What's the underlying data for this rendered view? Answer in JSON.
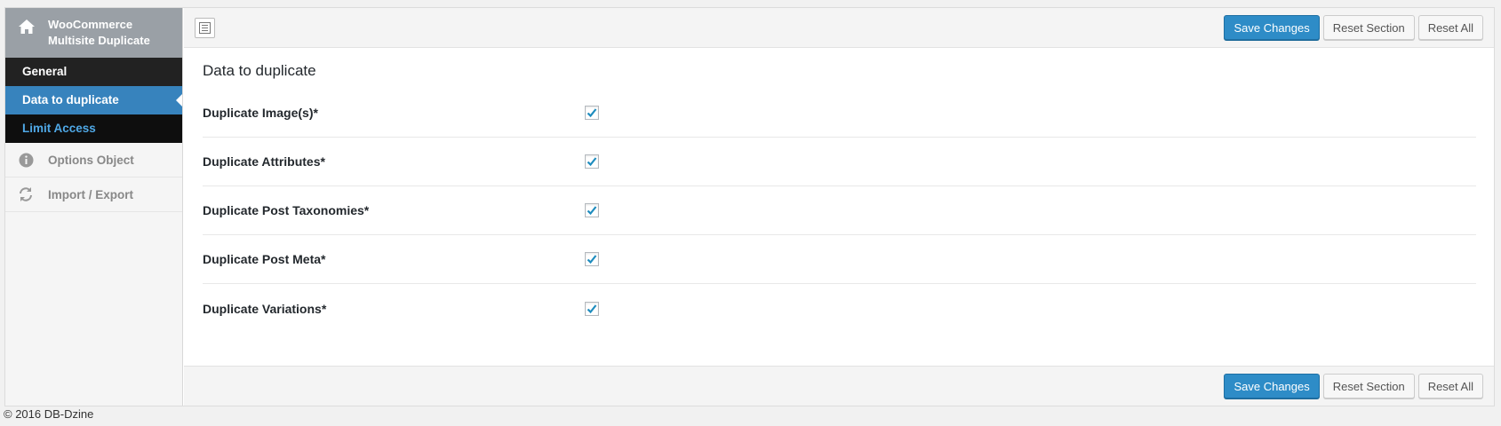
{
  "sidebar": {
    "brand_title": "WooCommerce Multisite Duplicate",
    "submenu": [
      {
        "label": "General"
      },
      {
        "label": "Data to duplicate"
      },
      {
        "label": "Limit Access"
      }
    ],
    "menu": [
      {
        "label": "Options Object",
        "icon": "info-icon"
      },
      {
        "label": "Import / Export",
        "icon": "refresh-icon"
      }
    ]
  },
  "toolbar": {
    "save_label": "Save Changes",
    "reset_section_label": "Reset Section",
    "reset_all_label": "Reset All"
  },
  "main": {
    "section_title": "Data to duplicate",
    "fields": [
      {
        "label": "Duplicate Image(s)*",
        "checked": true
      },
      {
        "label": "Duplicate Attributes*",
        "checked": true
      },
      {
        "label": "Duplicate Post Taxonomies*",
        "checked": true
      },
      {
        "label": "Duplicate Post Meta*",
        "checked": true
      },
      {
        "label": "Duplicate Variations*",
        "checked": true
      }
    ]
  },
  "footer": {
    "text": "© 2016 DB-Dzine"
  },
  "colors": {
    "accent": "#3783bd",
    "primary_button": "#2e8cc7",
    "checkmark": "#1e8cbe"
  }
}
